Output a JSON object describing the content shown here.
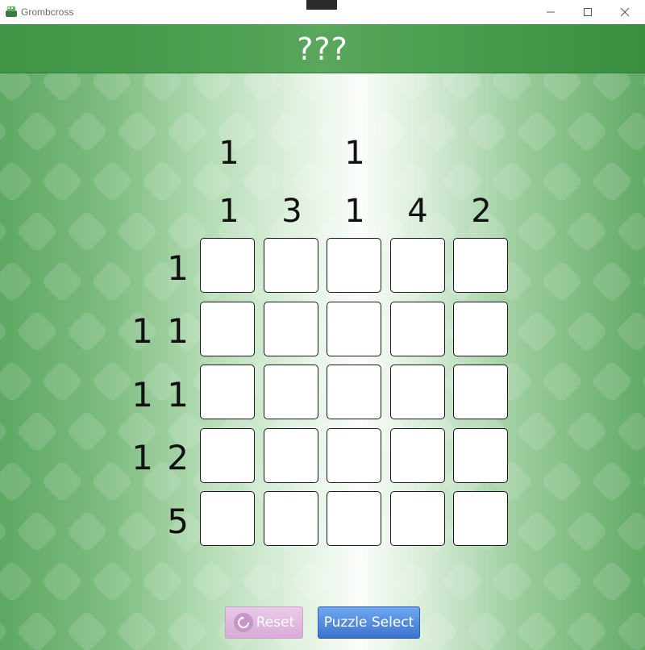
{
  "window": {
    "title": "Grombcross",
    "icon": "grombcross-app-icon",
    "controls": {
      "minimize": "minimize-icon",
      "maximize": "maximize-icon",
      "close": "close-icon"
    }
  },
  "header": {
    "title": "???"
  },
  "puzzle": {
    "size": "5x5",
    "column_clues": [
      [
        "1",
        "1"
      ],
      [
        "3"
      ],
      [
        "1",
        "1"
      ],
      [
        "4"
      ],
      [
        "2"
      ]
    ],
    "row_clues": [
      "1",
      "1 1",
      "1 1",
      "1 2",
      "5"
    ],
    "cells": [
      [
        0,
        0,
        0,
        0,
        0
      ],
      [
        0,
        0,
        0,
        0,
        0
      ],
      [
        0,
        0,
        0,
        0,
        0
      ],
      [
        0,
        0,
        0,
        0,
        0
      ],
      [
        0,
        0,
        0,
        0,
        0
      ]
    ]
  },
  "buttons": {
    "reset_label": "Reset",
    "reset_icon": "reset-icon",
    "puzzle_select_label": "Puzzle Select"
  },
  "colors": {
    "header_green": "#4d9f52",
    "reset_pink": "#d9a6d8",
    "select_blue": "#4a80d8"
  }
}
